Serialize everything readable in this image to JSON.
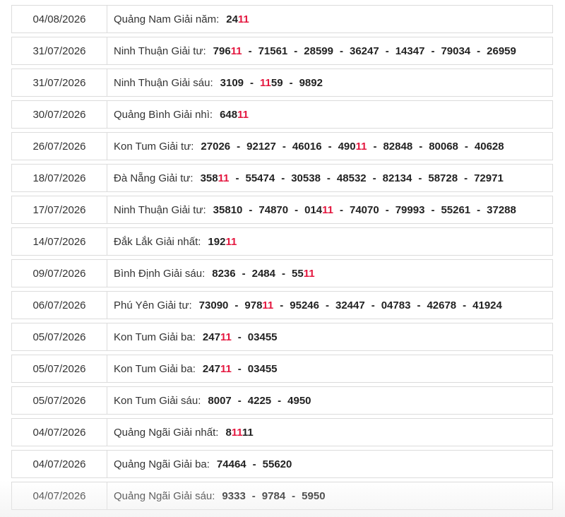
{
  "results": [
    {
      "date": "04/08/2026",
      "label": "Quảng Nam Giải năm:",
      "numbers": [
        "2411"
      ]
    },
    {
      "date": "31/07/2026",
      "label": "Ninh Thuận Giải tư:",
      "numbers": [
        "79611",
        "71561",
        "28599",
        "36247",
        "14347",
        "79034",
        "26959"
      ]
    },
    {
      "date": "31/07/2026",
      "label": "Ninh Thuận Giải sáu:",
      "numbers": [
        "3109",
        "1159",
        "9892"
      ]
    },
    {
      "date": "30/07/2026",
      "label": "Quảng Bình Giải nhì:",
      "numbers": [
        "64811"
      ]
    },
    {
      "date": "26/07/2026",
      "label": "Kon Tum Giải tư:",
      "numbers": [
        "27026",
        "92127",
        "46016",
        "49011",
        "82848",
        "80068",
        "40628"
      ]
    },
    {
      "date": "18/07/2026",
      "label": "Đà Nẵng Giải tư:",
      "numbers": [
        "35811",
        "55474",
        "30538",
        "48532",
        "82134",
        "58728",
        "72971"
      ]
    },
    {
      "date": "17/07/2026",
      "label": "Ninh Thuận Giải tư:",
      "numbers": [
        "35810",
        "74870",
        "01411",
        "74070",
        "79993",
        "55261",
        "37288"
      ]
    },
    {
      "date": "14/07/2026",
      "label": "Đắk Lắk Giải nhất:",
      "numbers": [
        "19211"
      ]
    },
    {
      "date": "09/07/2026",
      "label": "Bình Định Giải sáu:",
      "numbers": [
        "8236",
        "2484",
        "5511"
      ]
    },
    {
      "date": "06/07/2026",
      "label": "Phú Yên Giải tư:",
      "numbers": [
        "73090",
        "97811",
        "95246",
        "32447",
        "04783",
        "42678",
        "41924"
      ]
    },
    {
      "date": "05/07/2026",
      "label": "Kon Tum Giải ba:",
      "numbers": [
        "24711",
        "03455"
      ]
    },
    {
      "date": "05/07/2026",
      "label": "Kon Tum Giải ba:",
      "numbers": [
        "24711",
        "03455"
      ]
    },
    {
      "date": "05/07/2026",
      "label": "Kon Tum Giải sáu:",
      "numbers": [
        "8007",
        "4225",
        "4950"
      ]
    },
    {
      "date": "04/07/2026",
      "label": "Quảng Ngãi Giải nhất:",
      "numbers": [
        "81111"
      ]
    },
    {
      "date": "04/07/2026",
      "label": "Quảng Ngãi Giải ba:",
      "numbers": [
        "74464",
        "55620"
      ]
    },
    {
      "date": "04/07/2026",
      "label": "Quảng Ngãi Giải sáu:",
      "numbers": [
        "9333",
        "9784",
        "5950"
      ]
    }
  ],
  "highlight": "11",
  "separator": "-",
  "colors": {
    "highlight": "#e4173f",
    "text": "#222222",
    "border": "#dcdcdc"
  }
}
